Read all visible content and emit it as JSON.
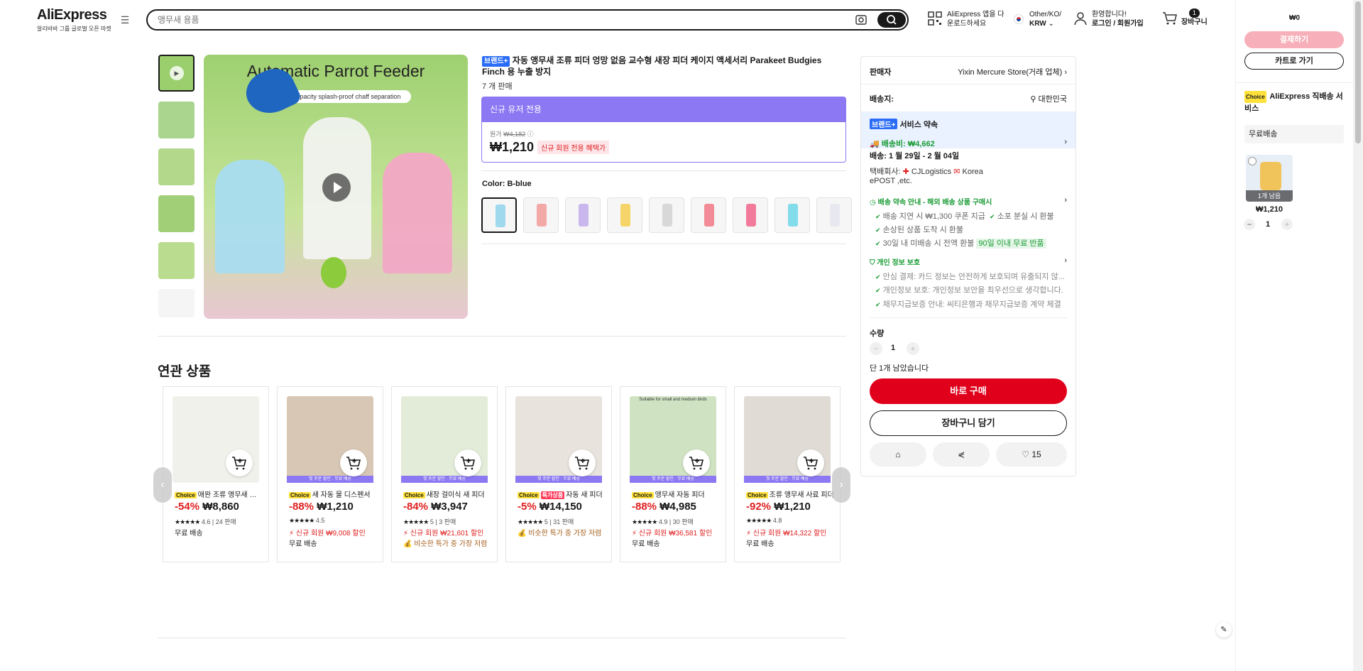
{
  "header": {
    "logo": "AliExpress",
    "logo_sub": "알리바바 그룹 글로벌 오픈 마켓",
    "search_placeholder": "앵무새 용품",
    "app_line1": "AliExpress 앱을 다",
    "app_line2": "운로드하세요",
    "region_line1": "Other/KO/",
    "region_line2": "KRW",
    "account_line1": "환영합니다!",
    "account_line2": "로그인 / 회원가입",
    "cart_count": "1",
    "cart_label": "장바구니"
  },
  "product": {
    "image_title": "Automatic Parrot Feeder",
    "image_sub": "Large-capacity splash-proof chaff separation",
    "brand_badge": "브랜드+",
    "title": "자동 앵무새 조류 피더 엉망 없음 교수형 새장 피더 케이지 액세서리 Parakeet Budgies Finch 용 누출 방지",
    "sold": "7 개 판매",
    "promo_head": "신규 유저 전용",
    "orig_label": "원가",
    "orig_price": "₩4,182",
    "price": "₩1,210",
    "price_tag": "신규 회원 전용 혜택가",
    "color_label": "Color: B-blue",
    "swatch_colors": [
      "#9fd9ee",
      "#f4a9a9",
      "#c9b7ee",
      "#f5d56a",
      "#d8d8d8",
      "#f28b95",
      "#f27b9b",
      "#82dcea",
      "#e8e8f0"
    ]
  },
  "related": {
    "title": "연관 상품",
    "cards": [
      {
        "chip": "Choice",
        "name": "애완 조류 앵무새 자동 피더",
        "pct": "-54%",
        "price": "₩8,860",
        "rating": "4.6",
        "sold": "24 판매",
        "line1": "무료 배송",
        "line2": "",
        "ribbon": "",
        "img": "#f1f1ec"
      },
      {
        "chip": "Choice",
        "name": "새 자동 물 디스펜서",
        "pct": "-88%",
        "price": "₩1,210",
        "rating": "4.5",
        "sold": "",
        "line1": "⚡ 신규 회원 ₩9,008 할인",
        "line2": "무료 배송",
        "ribbon": "첫 주문 할인 · 무료 배송",
        "img": "#d8c7b4"
      },
      {
        "chip": "Choice",
        "name": "새장 걸이식 새 피더",
        "pct": "-84%",
        "price": "₩3,947",
        "rating": "5",
        "sold": "3 판매",
        "line1": "⚡ 신규 회원 ₩21,601 할인",
        "line2": "💰 비슷한 특가 중 가장 저렴",
        "ribbon": "첫 주문 할인 · 무료 배송",
        "img": "#e3ecd8"
      },
      {
        "chip": "Choice",
        "chip2": "특가상품",
        "name": "자동 새 피더",
        "pct": "-5%",
        "price": "₩14,150",
        "rating": "5",
        "sold": "31 판매",
        "line1": "💰 비슷한 특가 중 가장 저렴",
        "line2": "",
        "ribbon": "첫 주문 할인 · 무료 배송",
        "img": "#e8e3dc"
      },
      {
        "chip": "Choice",
        "name": "앵무새 자동 피더",
        "pct": "-88%",
        "price": "₩4,985",
        "rating": "4.9",
        "sold": "30 판매",
        "line1": "⚡ 신규 회원 ₩36,581 할인",
        "line2": "무료 배송",
        "ribbon": "첫 주문 할인 · 무료 배송",
        "img": "#cfe3c3",
        "img_text": "Suitable for small and medium birds"
      },
      {
        "chip": "Choice",
        "name": "조류 앵무새 사료 피더",
        "pct": "-92%",
        "price": "₩1,210",
        "rating": "4.8",
        "sold": "",
        "line1": "⚡ 신규 회원 ₩14,322 할인",
        "line2": "무료 배송",
        "ribbon": "첫 주문 할인 · 무료 배송",
        "img": "#e0dcd5"
      }
    ]
  },
  "panel": {
    "seller_label": "판매자",
    "seller_name": "Yixin Mercure Store(거래 업체)",
    "ship_to_label": "배송지:",
    "ship_to": "대한민국",
    "brand_badge": "브랜드+",
    "service_promise": "서비스 약속",
    "shipping_fee": "배송비: ₩4,662",
    "delivery": "배송: 1 월 29일 - 2 월 04일",
    "courier_label": "택배회사:",
    "courier1": "CJLogistics",
    "courier2": "Korea",
    "courier3": "ePOST ,etc.",
    "promise_title": "배송 약속 안내 - 해외 배송 상품 구매시",
    "p1": "배송 지연 시 ₩1,300 쿠폰 지급",
    "p2": "소포 분실 시 환불",
    "p3": "손상된 상품 도착 시 환불",
    "p4": "30일 내 미배송 시 전액 환불",
    "p5": "90일 이내 무료 반품",
    "privacy_title": "개인 정보 보호",
    "v1": "안심 결제: 카드 정보는 안전하게 보호되며 유출되지 않...",
    "v2": "개인정보 보호: 개인정보 보안을 최우선으로 생각합니다.",
    "v3": "채무지급보증 안내: 씨티은행과 채무지급보증 계약 체결",
    "qty_label": "수량",
    "qty": "1",
    "stock": "단 1개 남았습니다",
    "buy_now": "바로 구매",
    "add_cart": "장바구니 담기",
    "wish_count": "15"
  },
  "sidecart": {
    "total": "₩0",
    "pay": "결제하기",
    "go_cart": "카트로 가기",
    "choice": "Choice",
    "service": "AliExpress 직배송 서비스",
    "free_ship": "무료배송",
    "stock_left": "1개 남음",
    "price": "₩1,210",
    "qty": "1"
  }
}
